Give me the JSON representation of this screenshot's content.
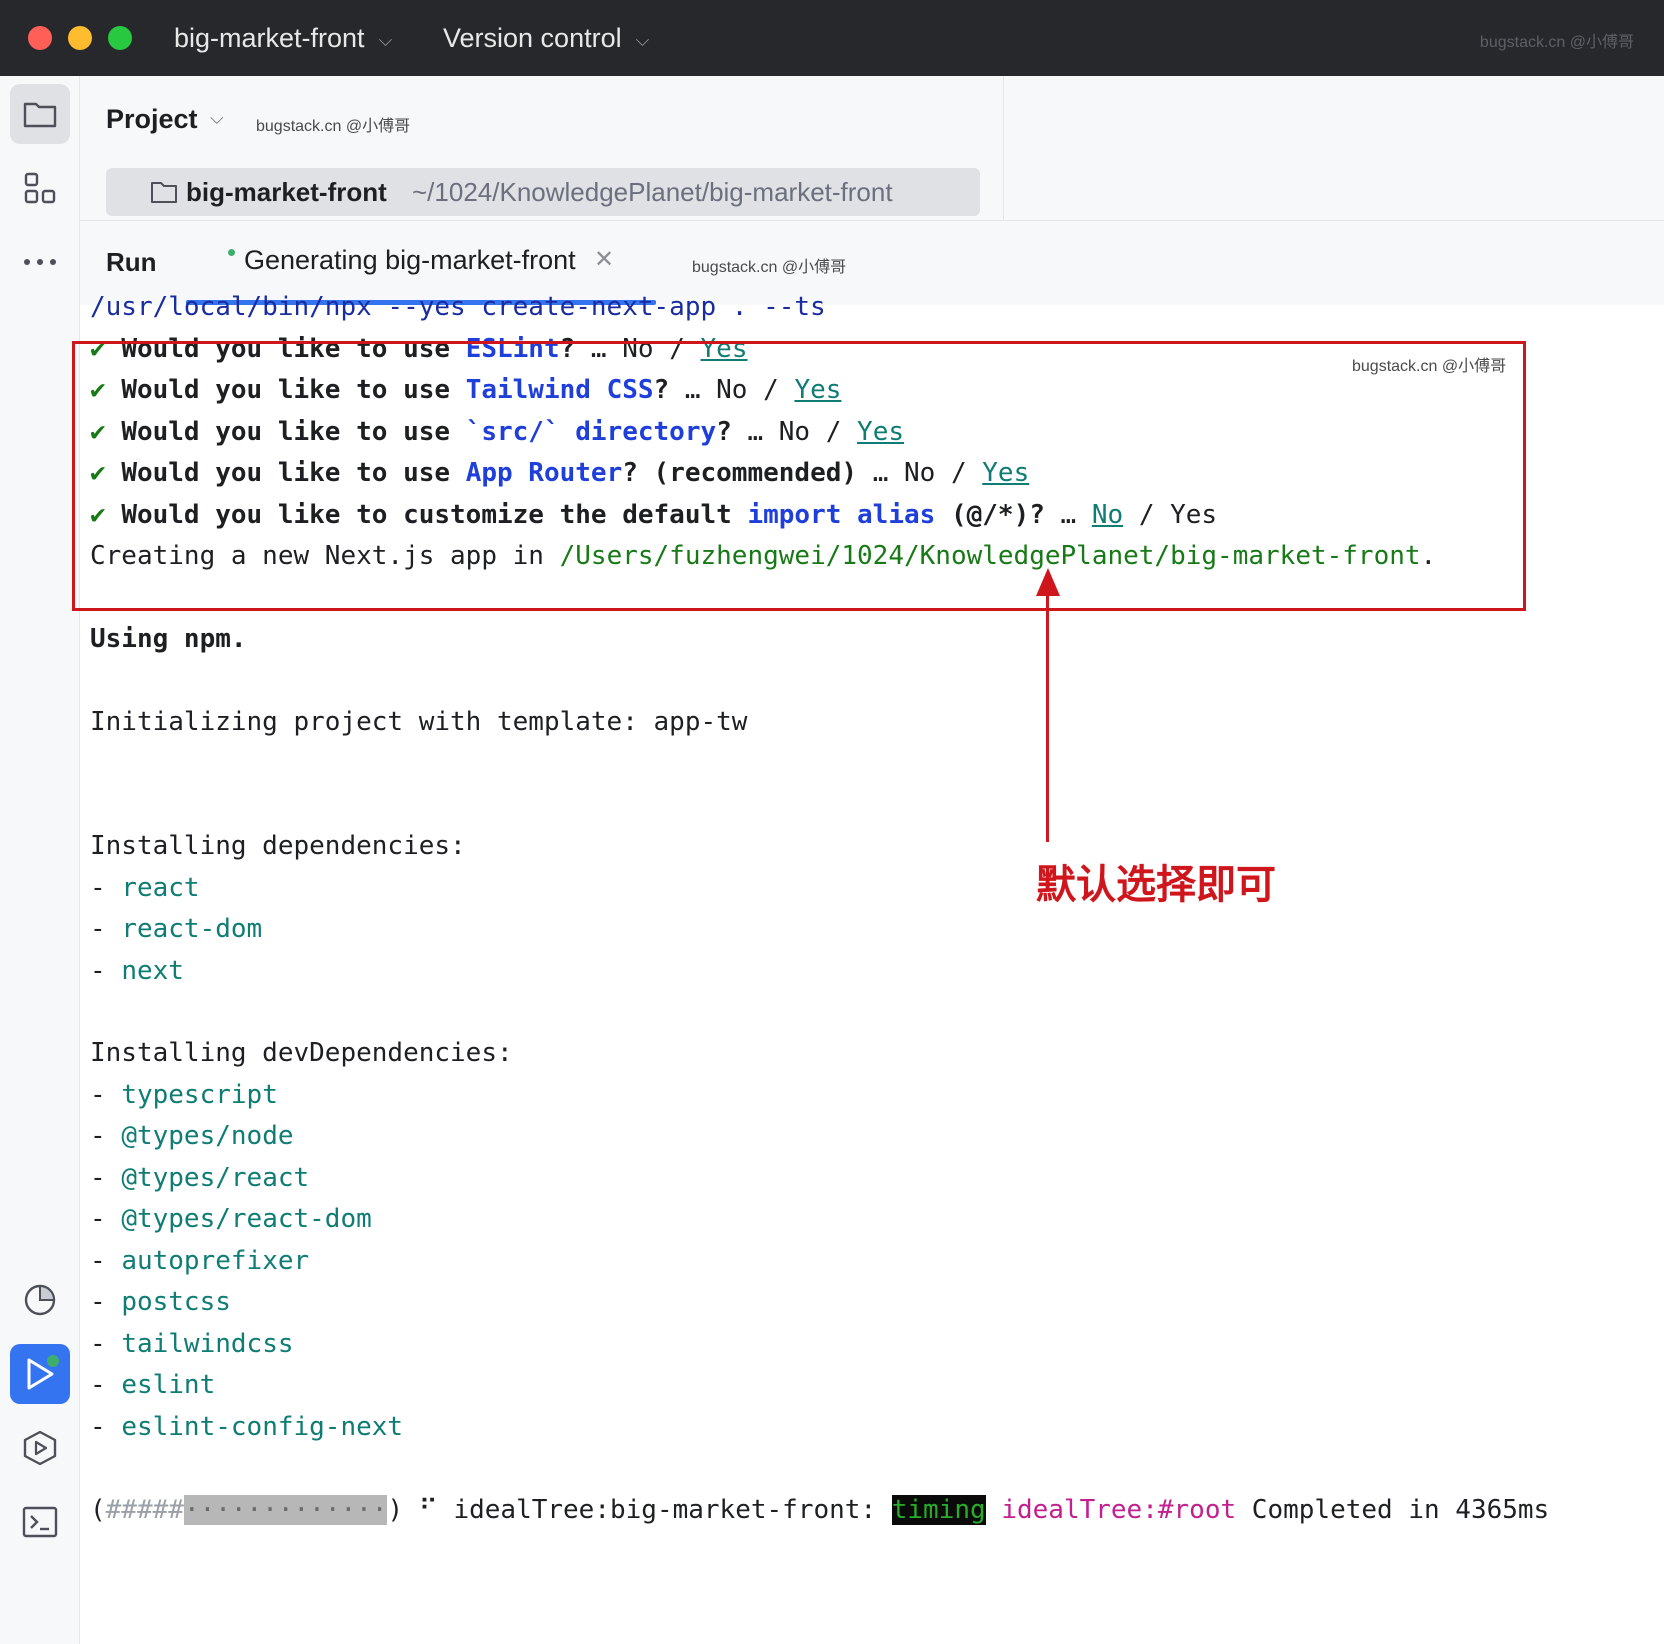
{
  "titlebar": {
    "project_name": "big-market-front",
    "vcs": "Version control",
    "watermark": "bugstack.cn @小傅哥"
  },
  "project_panel": {
    "title": "Project",
    "watermark": "bugstack.cn @小傅哥",
    "root_name": "big-market-front",
    "root_path": "~/1024/KnowledgePlanet/big-market-front"
  },
  "run": {
    "label": "Run",
    "tab_label": "Generating big-market-front",
    "watermark": "bugstack.cn @小傅哥"
  },
  "console": {
    "command": "/usr/local/bin/npx --yes create-next-app . --ts",
    "questions": [
      {
        "check": "✔",
        "prefix": "Would you like to use ",
        "highlight": "ESLint",
        "suffix": "? ",
        "ellipsis": "…",
        "no": "No",
        "sep": "/",
        "yes": "Yes",
        "selected": "yes"
      },
      {
        "check": "✔",
        "prefix": "Would you like to use ",
        "highlight": "Tailwind CSS",
        "suffix": "? ",
        "ellipsis": "…",
        "no": "No",
        "sep": "/",
        "yes": "Yes",
        "selected": "yes"
      },
      {
        "check": "✔",
        "prefix": "Would you like to use ",
        "highlight": "`src/` directory",
        "suffix": "? ",
        "ellipsis": "…",
        "no": "No",
        "sep": "/",
        "yes": "Yes",
        "selected": "yes"
      },
      {
        "check": "✔",
        "prefix": "Would you like to use ",
        "highlight": "App Router",
        "suffix": "? (recommended) ",
        "ellipsis": "…",
        "no": "No",
        "sep": "/",
        "yes": "Yes",
        "selected": "yes"
      },
      {
        "check": "✔",
        "prefix": "Would you like to customize the default ",
        "highlight": "import alias",
        "suffix": " (@/*)? ",
        "ellipsis": "…",
        "no": "No",
        "sep": "/",
        "yes": "Yes",
        "selected": "no"
      }
    ],
    "creating_prefix": "Creating a new Next.js app in ",
    "creating_path": "/Users/fuzhengwei/1024/KnowledgePlanet/big-market-front",
    "creating_suffix": ".",
    "using": "Using npm.",
    "init": "Initializing project with template: app-tw",
    "deps_header": "Installing dependencies:",
    "deps": [
      "react",
      "react-dom",
      "next"
    ],
    "dev_deps_header": "Installing devDependencies:",
    "dev_deps": [
      "typescript",
      "@types/node",
      "@types/react",
      "@types/react-dom",
      "autoprefixer",
      "postcss",
      "tailwindcss",
      "eslint",
      "eslint-config-next"
    ],
    "bullet": "- ",
    "progress": {
      "open": "(",
      "filled": "#####",
      "rest": "·············",
      "close": ")",
      "spinner": "⠋",
      "label": "idealTree:big-market-front:",
      "timing": "timing",
      "root": "idealTree:#root",
      "completed": "Completed in 4365ms"
    }
  },
  "annotation": {
    "watermark": "bugstack.cn @小傅哥",
    "text": "默认选择即可"
  },
  "colors": {
    "accent": "#3574f0",
    "annotation_red": "#d0161d",
    "link_teal": "#0f7d74",
    "keyword_blue": "#1f3fdb",
    "path_green": "#177a17"
  }
}
